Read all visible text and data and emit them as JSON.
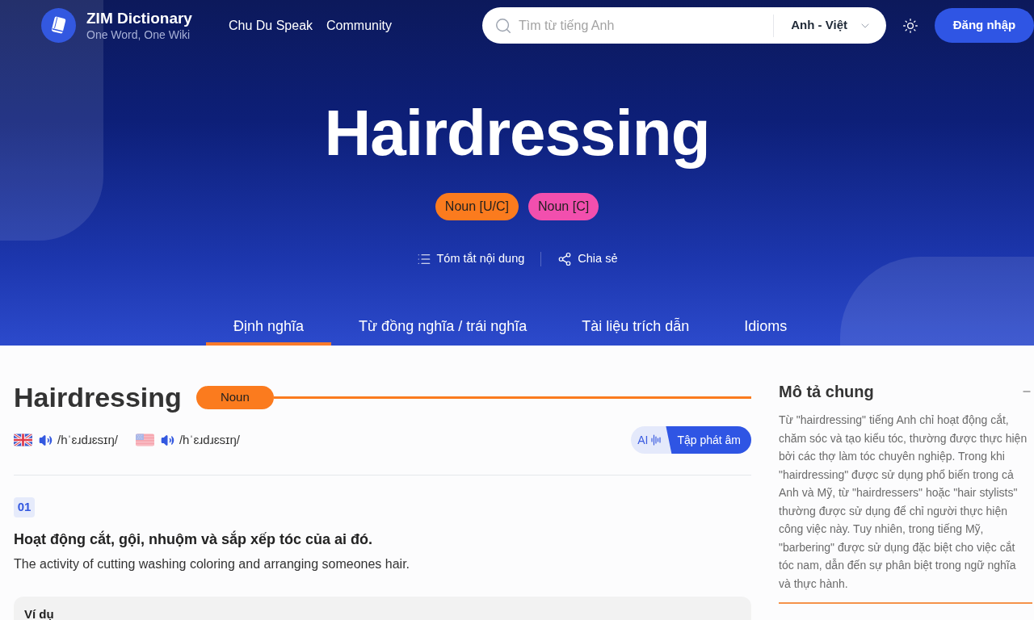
{
  "header": {
    "logo": {
      "title": "ZIM Dictionary",
      "tagline": "One Word, One Wiki"
    },
    "nav_links": [
      "Chu Du Speak",
      "Community"
    ],
    "search": {
      "placeholder": "Tìm từ tiếng Anh",
      "language": "Anh - Việt"
    },
    "login_button": "Đăng nhập"
  },
  "hero": {
    "title": "Hairdressing",
    "tags": [
      {
        "label": "Noun [U/C]",
        "color": "#fb7b1e"
      },
      {
        "label": "Noun [C]",
        "color": "#f24fae"
      }
    ],
    "actions": [
      {
        "kind": "summary",
        "label": "Tóm tắt nội dung"
      },
      {
        "kind": "share",
        "label": "Chia sẻ"
      }
    ],
    "tabs": [
      {
        "label": "Định nghĩa",
        "selected": true
      },
      {
        "label": "Từ đồng nghĩa / trái nghĩa",
        "selected": false
      },
      {
        "label": "Tài liệu trích dẫn",
        "selected": false
      },
      {
        "label": "Idioms",
        "selected": false
      }
    ]
  },
  "entry": {
    "word": "Hairdressing",
    "part_of_speech": "Noun",
    "pronunciations": [
      {
        "kind": "uk",
        "ipa": "/hˈɛɹdɹɛsɪŋ/"
      },
      {
        "kind": "us",
        "ipa": "/hˈɛɹdɹɛsɪŋ/"
      }
    ],
    "practice": {
      "ai_label": "AI",
      "button": "Tập phát âm"
    },
    "senses": [
      {
        "number": "01",
        "meaning_vi": "Hoạt động cắt, gội, nhuộm và sắp xếp tóc của ai đó.",
        "meaning_en": "The activity of cutting washing coloring and arranging someones hair.",
        "examples_heading": "Ví dụ"
      }
    ]
  },
  "sidebar": {
    "title": "Mô tả chung",
    "expanded": true,
    "text": "Từ \"hairdressing\" tiếng Anh chỉ hoạt động cắt, chăm sóc và tạo kiểu tóc, thường được thực hiện bởi các thợ làm tóc chuyên nghiệp. Trong khi \"hairdressing\" được sử dụng phổ biến trong cả Anh và Mỹ, từ \"hairdressers\" hoặc \"hair stylists\" thường được sử dụng để chỉ người thực hiện công việc này. Tuy nhiên, trong tiếng Mỹ, \"barbering\" được sử dụng đặc biệt cho việc cắt tóc nam, dẫn đến sự phân biệt trong ngữ nghĩa và thực hành."
  }
}
